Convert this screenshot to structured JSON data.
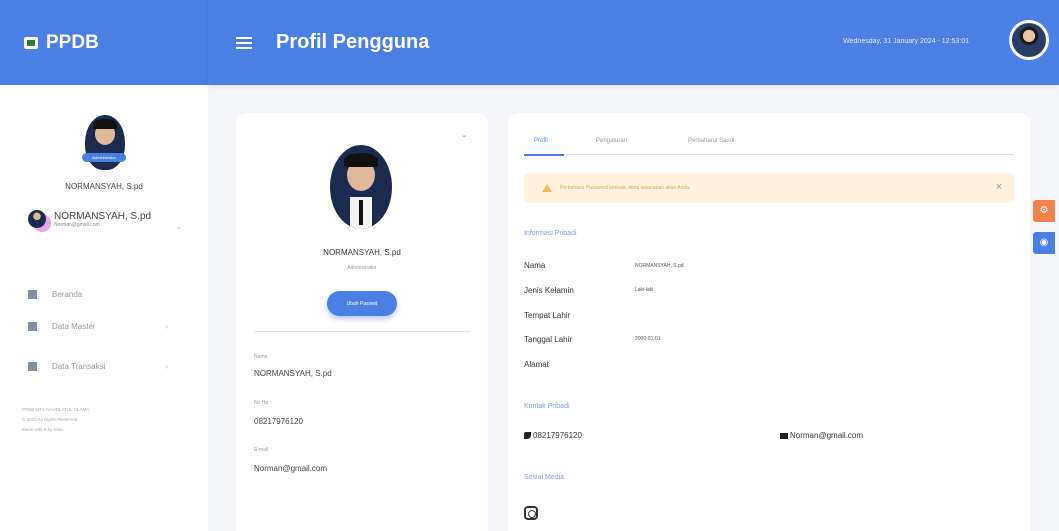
{
  "brand": {
    "name": "PPDB"
  },
  "header": {
    "title": "Profil Pengguna",
    "datetime": "Wednesday, 31 January 2024 - 12:53:01"
  },
  "sidebar": {
    "role_badge": "Administrator",
    "name": "NORMANSYAH, S.pd",
    "user_name": "NORMANSYAH, S.pd",
    "user_email": "Norman@gmail.com",
    "items": [
      {
        "label": "Beranda",
        "icon": "home-icon"
      },
      {
        "label": "Data Master",
        "icon": "table-icon"
      },
      {
        "label": "Data Transaksi",
        "icon": "database-icon"
      }
    ],
    "footer_line1": "PPDB MTS NAHDLATUL ULAMA",
    "footer_line2": "© 2023 All Rights Reserved",
    "footer_line3": "Made with ♥ by retsu"
  },
  "profile_card": {
    "name": "NORMANSYAH, S.pd",
    "role": "Administrator",
    "button_label": "Ubah Passwd",
    "name_label": "Nama",
    "name_value": "NORMANSYAH, S.pd",
    "phone_label": "No Hp",
    "phone_value": "08217976120",
    "email_label": "E-mail",
    "email_value": "Norman@gmail.com"
  },
  "tabs": [
    "Profil",
    "Pengaturan",
    "Perbaharui Sandi"
  ],
  "alert": {
    "text": "Perbaharui Password berkala, demi keamanan akun Anda."
  },
  "personal": {
    "section_title": "Informasi Pribadi",
    "fields": [
      {
        "label": "Nama",
        "value": "NORMANSYAH, S.pd"
      },
      {
        "label": "Jenis Kelamin",
        "value": "Laki-laki"
      },
      {
        "label": "Tempat Lahir",
        "value": ""
      },
      {
        "label": "Tanggal Lahir",
        "value": "2000-01-01"
      },
      {
        "label": "Alamat",
        "value": ""
      }
    ]
  },
  "contact": {
    "section_title": "Kontak Pribadi",
    "phone": "08217976120",
    "email": "Norman@gmail.com"
  },
  "social": {
    "section_title": "Sosial Media"
  },
  "colors": {
    "primary": "#4a7fe4",
    "settings_button": "#f0824b"
  }
}
